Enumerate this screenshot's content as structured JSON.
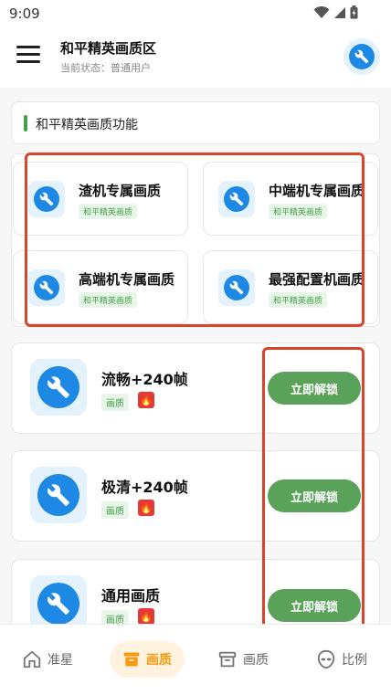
{
  "status_bar": {
    "time": "9:09"
  },
  "header": {
    "title": "和平精英画质区",
    "subtitle": "当前状态：普通用户"
  },
  "section": {
    "title": "和平精英画质功能"
  },
  "grid_cards": [
    {
      "title": "渣机专属画质",
      "tag": "和平精英画质"
    },
    {
      "title": "中端机专属画质",
      "tag": "和平精英画质"
    },
    {
      "title": "高端机专属画质",
      "tag": "和平精英画质"
    },
    {
      "title": "最强配置机画质",
      "tag": "和平精英画质"
    }
  ],
  "list_cards": [
    {
      "title": "流畅+240帧",
      "tag": "画质",
      "button": "立即解锁"
    },
    {
      "title": "极清+240帧",
      "tag": "画质",
      "button": "立即解锁"
    },
    {
      "title": "通用画质",
      "tag": "画质",
      "button": "立即解锁"
    }
  ],
  "bottom_nav": [
    {
      "label": "准星",
      "icon": "home-icon"
    },
    {
      "label": "画质",
      "icon": "box-icon",
      "active": true
    },
    {
      "label": "画质",
      "icon": "archive-icon"
    },
    {
      "label": "比例",
      "icon": "alien-icon"
    }
  ],
  "colors": {
    "accent_blue": "#1e88e5",
    "tile_blue": "#e3f2fc",
    "green_button": "#5aa25a",
    "green_tag": "#43a047",
    "annotation_red": "#d9452b",
    "active_orange": "#f39c12"
  }
}
